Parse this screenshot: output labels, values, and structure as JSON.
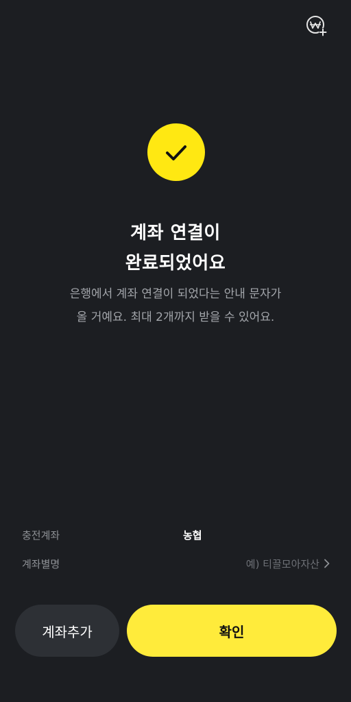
{
  "header": {
    "icon": "won-plus-icon"
  },
  "status": {
    "icon": "check-icon",
    "accent_color": "#ffe812",
    "title_line1": "계좌 연결이",
    "title_line2": "완료되었어요",
    "desc_line1": "은행에서 계좌 연결이 되었다는 안내 문자가",
    "desc_line2": "올 거예요. 최대 2개까지 받을 수 있어요."
  },
  "account": {
    "charge_label": "충전계좌",
    "charge_value": "농협",
    "alias_label": "계좌별명",
    "alias_placeholder": "예) 티끌모아자산",
    "alias_icon": "chevron-right-icon"
  },
  "buttons": {
    "add_label": "계좌추가",
    "confirm_label": "확인"
  }
}
